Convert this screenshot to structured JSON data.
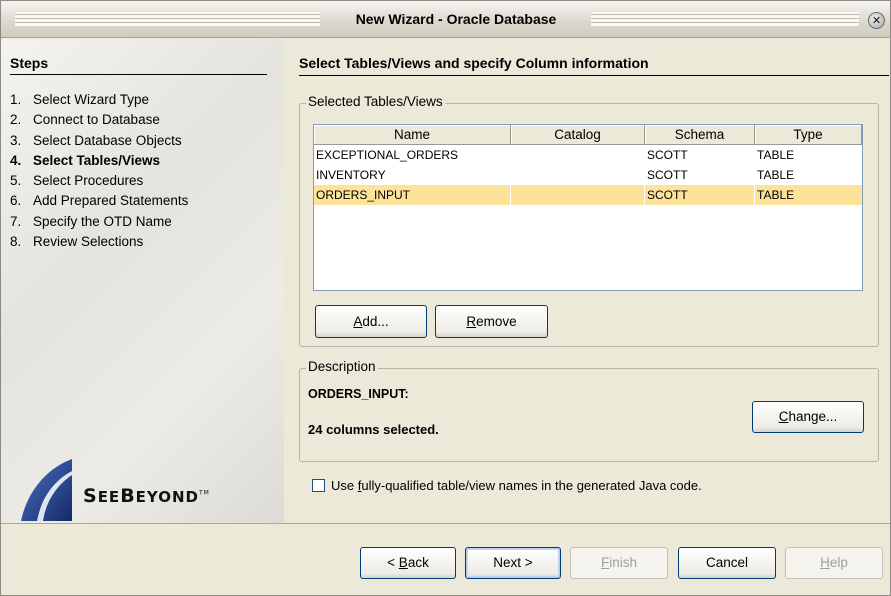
{
  "window": {
    "title": "New Wizard - Oracle Database",
    "close_glyph": "✕"
  },
  "steps": {
    "title": "Steps",
    "items": [
      {
        "num": "1.",
        "label": "Select Wizard Type"
      },
      {
        "num": "2.",
        "label": "Connect to Database"
      },
      {
        "num": "3.",
        "label": "Select Database Objects"
      },
      {
        "num": "4.",
        "label": "Select Tables/Views"
      },
      {
        "num": "5.",
        "label": "Select Procedures"
      },
      {
        "num": "6.",
        "label": "Add Prepared Statements"
      },
      {
        "num": "7.",
        "label": "Specify the OTD Name"
      },
      {
        "num": "8.",
        "label": "Review Selections"
      }
    ],
    "current_index": 3
  },
  "logo": {
    "text_big1": "S",
    "text_small1": "EE",
    "text_big2": "B",
    "text_small2": "EYOND",
    "tm": "TM"
  },
  "main": {
    "title": "Select Tables/Views and specify Column information",
    "tables_group": {
      "legend": "Selected Tables/Views",
      "columns": [
        "Name",
        "Catalog",
        "Schema",
        "Type"
      ],
      "rows": [
        {
          "name": "EXCEPTIONAL_ORDERS",
          "catalog": "",
          "schema": "SCOTT",
          "type": "TABLE",
          "selected": false
        },
        {
          "name": "INVENTORY",
          "catalog": "",
          "schema": "SCOTT",
          "type": "TABLE",
          "selected": false
        },
        {
          "name": "ORDERS_INPUT",
          "catalog": "",
          "schema": "SCOTT",
          "type": "TABLE",
          "selected": true
        }
      ],
      "add_button": {
        "mnemonic": "A",
        "rest": "dd..."
      },
      "remove_button": {
        "mnemonic": "R",
        "rest": "emove"
      }
    },
    "description_group": {
      "legend": "Description",
      "name": "ORDERS_INPUT:",
      "count": "24 columns selected.",
      "change_button": {
        "mnemonic": "C",
        "rest": "hange..."
      }
    },
    "fq_checkbox": {
      "checked": false,
      "label_pre": "Use ",
      "mnemonic": "f",
      "label_post": "ully-qualified table/view names in the generated Java code."
    }
  },
  "buttons": {
    "back": {
      "pre": "< ",
      "mnemonic": "B",
      "rest": "ack"
    },
    "next": {
      "label": "Next >"
    },
    "finish": {
      "mnemonic": "F",
      "rest": "inish"
    },
    "cancel": {
      "label": "Cancel"
    },
    "help": {
      "mnemonic": "H",
      "rest": "elp"
    }
  },
  "colors": {
    "selection": "#fde39a",
    "logo_blue": "#1f3f8a"
  }
}
